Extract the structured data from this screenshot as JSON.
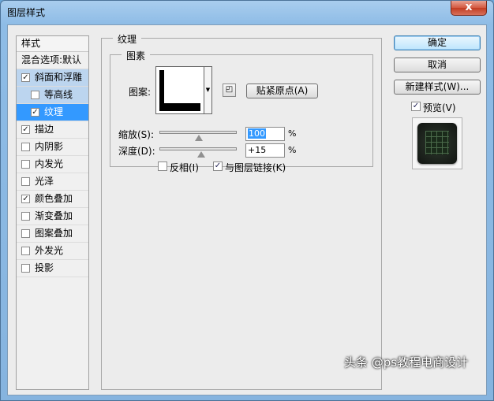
{
  "window": {
    "title": "图层样式",
    "close_glyph": "x"
  },
  "style_list": {
    "header": "样式",
    "blend_options": "混合选项:默认",
    "items": [
      {
        "label": "斜面和浮雕",
        "checked": true,
        "state": "highlight"
      },
      {
        "label": "等高线",
        "checked": false,
        "state": "highlight",
        "sub": true
      },
      {
        "label": "纹理",
        "checked": true,
        "state": "selected",
        "sub": true
      },
      {
        "label": "描边",
        "checked": true
      },
      {
        "label": "内阴影",
        "checked": false
      },
      {
        "label": "内发光",
        "checked": false
      },
      {
        "label": "光泽",
        "checked": false
      },
      {
        "label": "颜色叠加",
        "checked": true
      },
      {
        "label": "渐变叠加",
        "checked": false
      },
      {
        "label": "图案叠加",
        "checked": false
      },
      {
        "label": "外发光",
        "checked": false
      },
      {
        "label": "投影",
        "checked": false
      }
    ]
  },
  "texture_panel": {
    "title": "纹理",
    "elements_title": "图素",
    "pattern_label": "图案:",
    "snap_origin_label": "贴紧原点(A)",
    "scale_label": "缩放(S):",
    "scale_value": "100",
    "scale_unit": "%",
    "scale_percent": 100,
    "depth_label": "深度(D):",
    "depth_value": "+15",
    "depth_unit": "%",
    "depth_percent": 15,
    "invert_label": "反相(I)",
    "invert_checked": false,
    "link_label": "与图层链接(K)",
    "link_checked": true
  },
  "buttons": {
    "ok": "确定",
    "cancel": "取消",
    "new_style": "新建样式(W)..."
  },
  "preview": {
    "label": "预览(V)",
    "checked": true
  },
  "watermark": "头条 @ps教程电商设计",
  "colors": {
    "selected_item": "#3399ff",
    "highlight_item": "#bcd5ef",
    "close_button": "#c94a31"
  }
}
